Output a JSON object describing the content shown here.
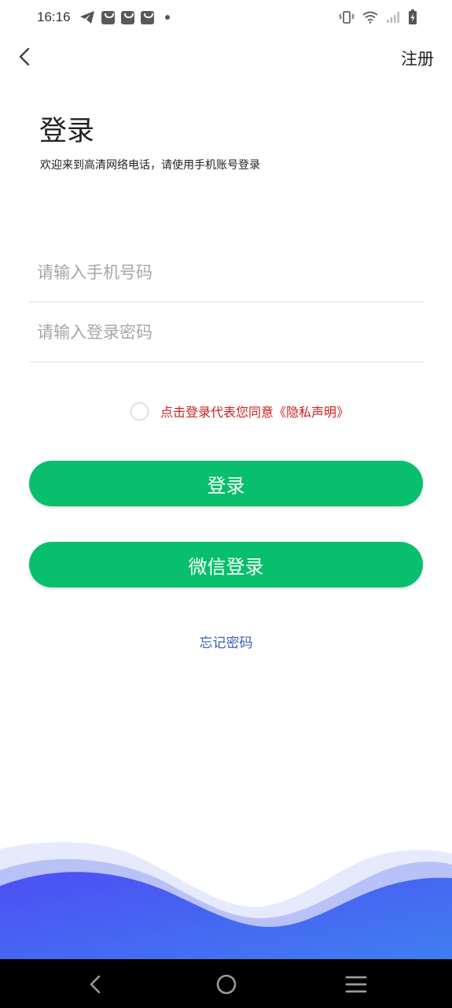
{
  "status_bar": {
    "time": "16:16"
  },
  "header": {
    "register_label": "注册"
  },
  "login": {
    "title": "登录",
    "subtitle": "欢迎来到高清网络电话，请使用手机账号登录",
    "phone_placeholder": "请输入手机号码",
    "password_placeholder": "请输入登录密码",
    "agreement_text": "点击登录代表您同意《隐私声明》",
    "login_button": "登录",
    "wechat_button": "微信登录",
    "forgot_password": "忘记密码"
  },
  "colors": {
    "primary_green": "#07bf6c",
    "agreement_red": "#cc1f1f",
    "link_blue": "#3b5fb6",
    "wave_blue": "#4a5cf5"
  }
}
